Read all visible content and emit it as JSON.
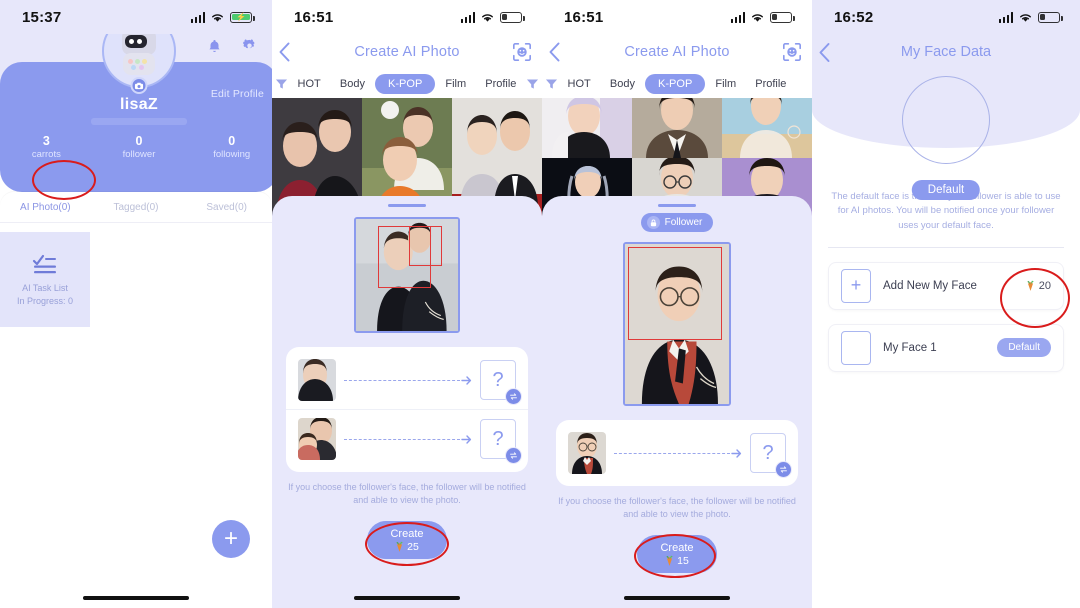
{
  "panels": {
    "profile": {
      "status": {
        "time": "15:37",
        "battery": "charging"
      },
      "icons": {
        "bell": "bell-icon",
        "gear": "gear-icon"
      },
      "edit_profile": "Edit Profile",
      "username": "lisaZ",
      "stats": [
        {
          "num": "3",
          "label": "carrots"
        },
        {
          "num": "0",
          "label": "follower"
        },
        {
          "num": "0",
          "label": "following"
        }
      ],
      "tabs": [
        {
          "label": "AI Photo(0)",
          "active": true
        },
        {
          "label": "Tagged(0)",
          "active": false
        },
        {
          "label": "Saved(0)",
          "active": false
        }
      ],
      "task_card": {
        "title": "AI Task List",
        "subtitle": "In Progress: 0"
      },
      "fab": "+"
    },
    "create_left": {
      "status": {
        "time": "16:51",
        "battery": "low"
      },
      "nav": {
        "back": "back-icon",
        "title": "Create AI Photo",
        "scan": "face-scan-icon"
      },
      "categories": [
        {
          "label": "HOT",
          "active": false
        },
        {
          "label": "Body",
          "active": false
        },
        {
          "label": "K-POP",
          "active": true
        },
        {
          "label": "Film",
          "active": false
        },
        {
          "label": "Profile",
          "active": false
        }
      ],
      "swap_rows": [
        {
          "question": "?"
        },
        {
          "question": "?"
        }
      ],
      "hint": "If you choose the follower's face, the follower will be notified and able to view the photo.",
      "create": {
        "label": "Create",
        "cost": "25"
      }
    },
    "create_right": {
      "status": {
        "time": "16:51",
        "battery": "low"
      },
      "nav": {
        "back": "back-icon",
        "title": "Create AI Photo",
        "scan": "face-scan-icon"
      },
      "categories": [
        {
          "label": "HOT",
          "active": false
        },
        {
          "label": "Body",
          "active": false
        },
        {
          "label": "K-POP",
          "active": true
        },
        {
          "label": "Film",
          "active": false
        },
        {
          "label": "Profile",
          "active": false
        }
      ],
      "follower_badge": "Follower",
      "swap_rows": [
        {
          "question": "?"
        }
      ],
      "hint": "If you choose the follower's face, the follower will be notified and able to view the photo.",
      "create": {
        "label": "Create",
        "cost": "15"
      }
    },
    "face_data": {
      "status": {
        "time": "16:52",
        "battery": "low"
      },
      "nav": {
        "back": "back-icon",
        "title": "My Face Data"
      },
      "default_pill": "Default",
      "description": "The default face is the face your follower is able to use for AI photos. You will be notified once your follower uses your default face.",
      "rows": [
        {
          "label": "Add New My Face",
          "cost": "20",
          "badge": null,
          "icon": "plus-icon"
        },
        {
          "label": "My Face 1",
          "cost": null,
          "badge": "Default",
          "icon": "empty-thumb-icon"
        }
      ]
    }
  },
  "colors": {
    "accent": "#8b9aee",
    "lavender_bg": "#e8e8fb",
    "header_bg": "#e7e7fa",
    "annotation": "#d91c1c",
    "text_muted": "#a4abdd"
  }
}
